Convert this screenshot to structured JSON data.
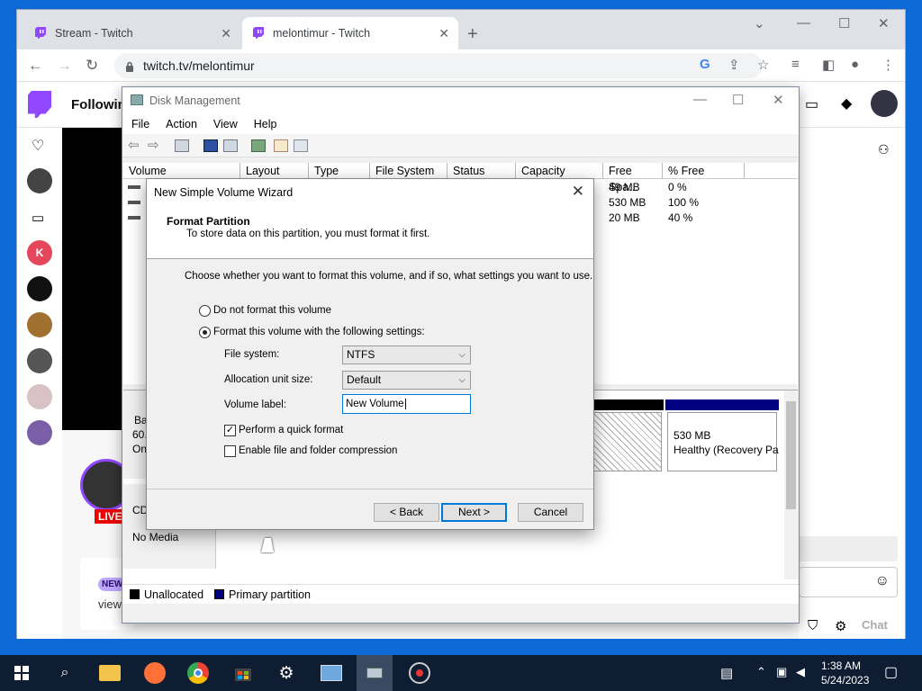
{
  "browser": {
    "tabs": [
      {
        "label": "Stream - Twitch"
      },
      {
        "label": "melontimur - Twitch"
      }
    ],
    "url": "twitch.tv/melontimur"
  },
  "twitch": {
    "nav_following": "Following",
    "live_badge": "LIVE",
    "new_badge": "NEW",
    "views_fragment": "view",
    "chat_label": "Chat"
  },
  "disk_management": {
    "title": "Disk Management",
    "menu": [
      "File",
      "Action",
      "View",
      "Help"
    ],
    "columns": [
      "Volume",
      "Layout",
      "Type",
      "File System",
      "Status",
      "Capacity",
      "Free Spa...",
      "% Free"
    ],
    "rows": [
      {
        "free": "49 MB",
        "pct": "0 %"
      },
      {
        "free": "530 MB",
        "pct": "100 %"
      },
      {
        "free": "20 MB",
        "pct": "40 %"
      }
    ],
    "disk0_fragments": [
      "Ba",
      "60.",
      "On"
    ],
    "cdrom_fragment": "CD",
    "cdrom_media": "No Media",
    "recovery_size": "530 MB",
    "recovery_status": "Healthy (Recovery Pa",
    "legend": [
      "Unallocated",
      "Primary partition"
    ],
    "legend_colors": [
      "#000000",
      "#000080"
    ]
  },
  "wizard": {
    "title": "New Simple Volume Wizard",
    "heading": "Format Partition",
    "subheading": "To store data on this partition, you must format it first.",
    "prompt": "Choose whether you want to format this volume, and if so, what settings you want to use.",
    "option_no_format": "Do not format this volume",
    "option_format": "Format this volume with the following settings:",
    "file_system_label": "File system:",
    "file_system_value": "NTFS",
    "alloc_label": "Allocation unit size:",
    "alloc_value": "Default",
    "volume_label_label": "Volume label:",
    "volume_label_value": "New Volume",
    "quick_format": "Perform a quick format",
    "compression": "Enable file and folder compression",
    "back": "< Back",
    "next": "Next >",
    "cancel": "Cancel"
  },
  "taskbar": {
    "time": "1:38 AM",
    "date": "5/24/2023"
  }
}
